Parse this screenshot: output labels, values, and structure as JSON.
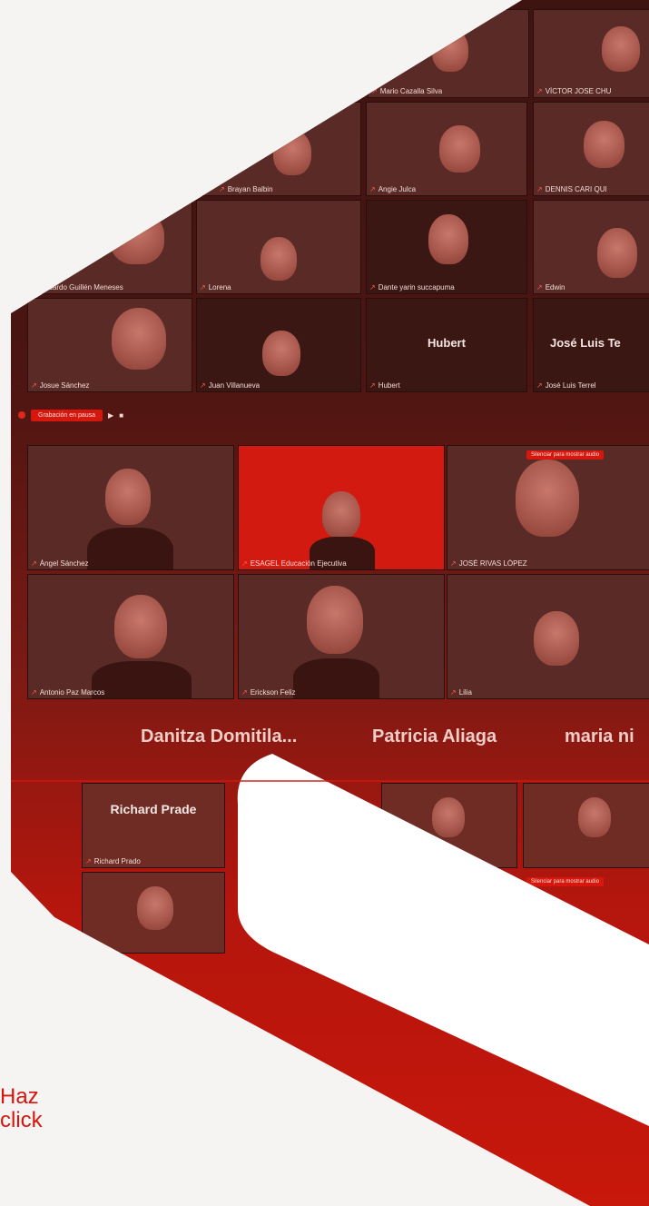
{
  "gallery_top": [
    {
      "name": "Mario Cazalla Silva"
    },
    {
      "name": "VÍCTOR JOSE CHU"
    },
    {
      "name": "Brayan Balbin"
    },
    {
      "name": "Angie Julca"
    },
    {
      "name": "DENNIS CARI QUI"
    },
    {
      "name": "Eduardo Guillén Meneses"
    },
    {
      "name": "Lorena"
    },
    {
      "name": "Dante yarin succapuma"
    },
    {
      "name": "Edwin"
    },
    {
      "name": "Josue Sánchez"
    },
    {
      "name": "Juan Villanueva"
    },
    {
      "name": "Hubert",
      "big": "Hubert"
    },
    {
      "name": "José Luis Terrel",
      "big": "José Luis Te"
    }
  ],
  "toolbar": {
    "recording_label": "Grabación en pausa",
    "play_icon": "play-icon",
    "stop_icon": "stop-icon"
  },
  "gallery_mid": [
    {
      "name": "Ángel Sánchez"
    },
    {
      "name": "ESAGEL Educación Ejecutiva"
    },
    {
      "name": "JOSÉ RIVAS LÓPEZ"
    },
    {
      "name": "Antonio Paz Marcos"
    },
    {
      "name": "Erickson Feliz"
    },
    {
      "name": "Lilia"
    }
  ],
  "unmute_label": "Silenciar para mostrar audio",
  "big_names": [
    "Danitza Domitila...",
    "Patricia Aliaga",
    "maria ni"
  ],
  "gallery_bottom": [
    {
      "name": "Richard Prado",
      "big": "Richard Prade"
    }
  ],
  "cta": {
    "line1": "Haz",
    "line2": "click"
  },
  "colors": {
    "brand_red": "#d4160d",
    "dark": "#3e1411",
    "background": "#f6f4f3"
  }
}
